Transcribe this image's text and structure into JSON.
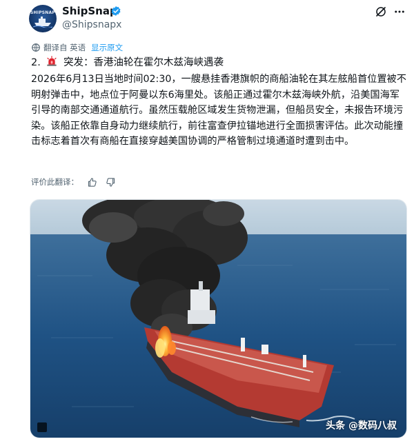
{
  "post": {
    "display_name": "ShipSnap",
    "handle": "@Shipsnapx",
    "avatar_text": "SHIPSNAP",
    "translation": {
      "label": "翻译自 英语",
      "show_original": "显示原文"
    },
    "title_prefix": "2.",
    "title_text": "突发：香港油轮在霍尔木兹海峡遇袭",
    "body": "2026年6月13日当地时间02:30，一艘悬挂香港旗帜的商船油轮在其左舷船首位置被不明射弹击中，地点位于阿曼以东6海里处。该船正通过霍尔木兹海峡外航，沿美国海军引导的南部交通通道航行。虽然压载舱区域发生货物泄漏，但船员安全，未报告环境污染。该船正依靠自身动力继续航行，前往富查伊拉锚地进行全面损害评估。此次动能撞击标志着首次有商船在直接穿越美国协调的严格管制过境通道时遭到击中。",
    "rate_translation": "评价此翻译：",
    "image_watermark": "头条 @数码八叔"
  },
  "icons": {
    "verified": "verified-badge-icon",
    "grok": "grok-icon",
    "more": "more-icon",
    "translate": "translate-icon",
    "siren": "siren-icon",
    "thumbs_up": "thumbs-up-icon",
    "thumbs_down": "thumbs-down-icon"
  },
  "colors": {
    "accent": "#1d9bf0",
    "text": "#0f1419",
    "muted": "#536471"
  }
}
